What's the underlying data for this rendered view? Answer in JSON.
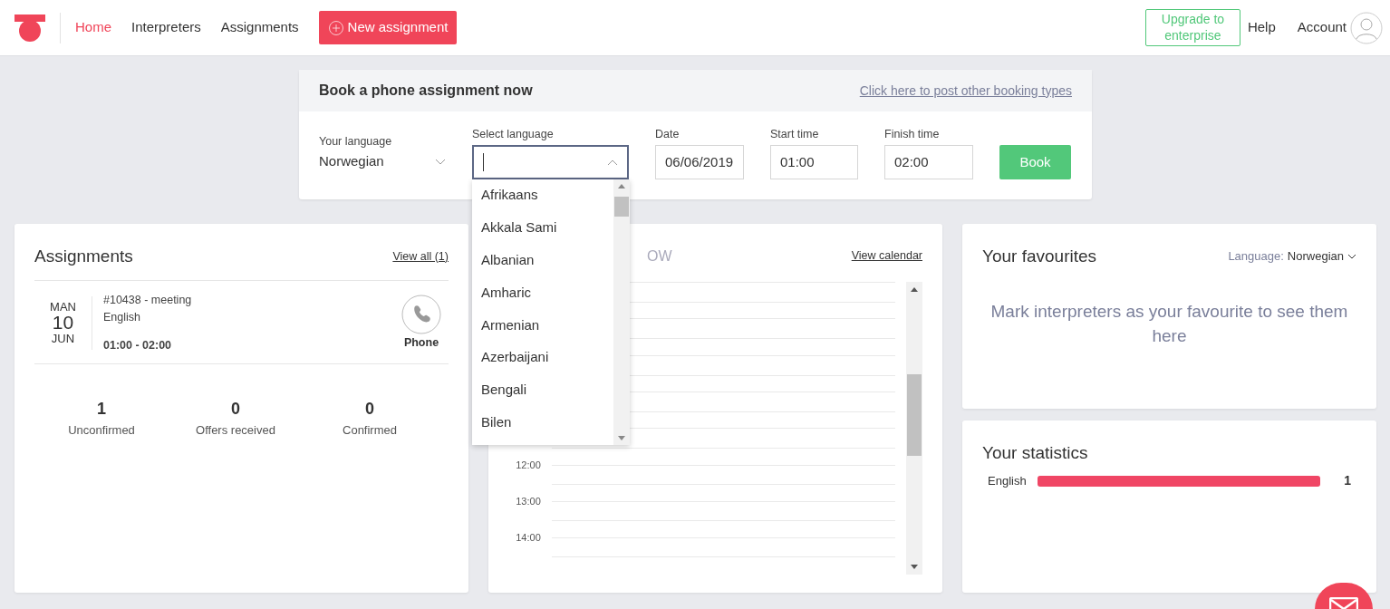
{
  "nav": {
    "items": [
      {
        "label": "Home",
        "selected": true
      },
      {
        "label": "Interpreters",
        "selected": false
      },
      {
        "label": "Assignments",
        "selected": false
      }
    ],
    "new_button": "New assignment",
    "upgrade": "Upgrade to enterprise",
    "help": "Help",
    "account": "Account"
  },
  "booking": {
    "title": "Book a phone assignment now",
    "other_link": "Click here to post other booking types",
    "your_language": {
      "label": "Your language",
      "value": "Norwegian"
    },
    "select_language": {
      "label": "Select language",
      "expanded": true,
      "options": [
        "Afrikaans",
        "Akkala Sami",
        "Albanian",
        "Amharic",
        "Armenian",
        "Azerbaijani",
        "Bengali",
        "Bilen"
      ]
    },
    "date": {
      "label": "Date",
      "value": "06/06/2019"
    },
    "start": {
      "label": "Start time",
      "value": "01:00"
    },
    "finish": {
      "label": "Finish time",
      "value": "02:00"
    },
    "book_button": "Book"
  },
  "assignments": {
    "title": "Assignments",
    "view_all": "View all (1)",
    "items": [
      {
        "weekday": "MAN",
        "day": "10",
        "month": "JUN",
        "title": "#10438 - meeting",
        "language": "English",
        "time": "01:00 - 02:00",
        "type": "Phone"
      }
    ],
    "counts": [
      {
        "value": "1",
        "label": "Unconfirmed"
      },
      {
        "value": "0",
        "label": "Offers received"
      },
      {
        "value": "0",
        "label": "Confirmed"
      }
    ]
  },
  "calendar": {
    "title_visible": "OW",
    "view_calendar": "View calendar",
    "hours": [
      "12:00",
      "13:00",
      "14:00"
    ]
  },
  "favourites": {
    "title": "Your favourites",
    "language_label": "Language:",
    "language_value": "Norwegian",
    "empty_text": "Mark interpreters as your favourite to see them here"
  },
  "statistics": {
    "title": "Your statistics",
    "rows": [
      {
        "language": "English",
        "level": 1,
        "count": "1"
      }
    ]
  }
}
